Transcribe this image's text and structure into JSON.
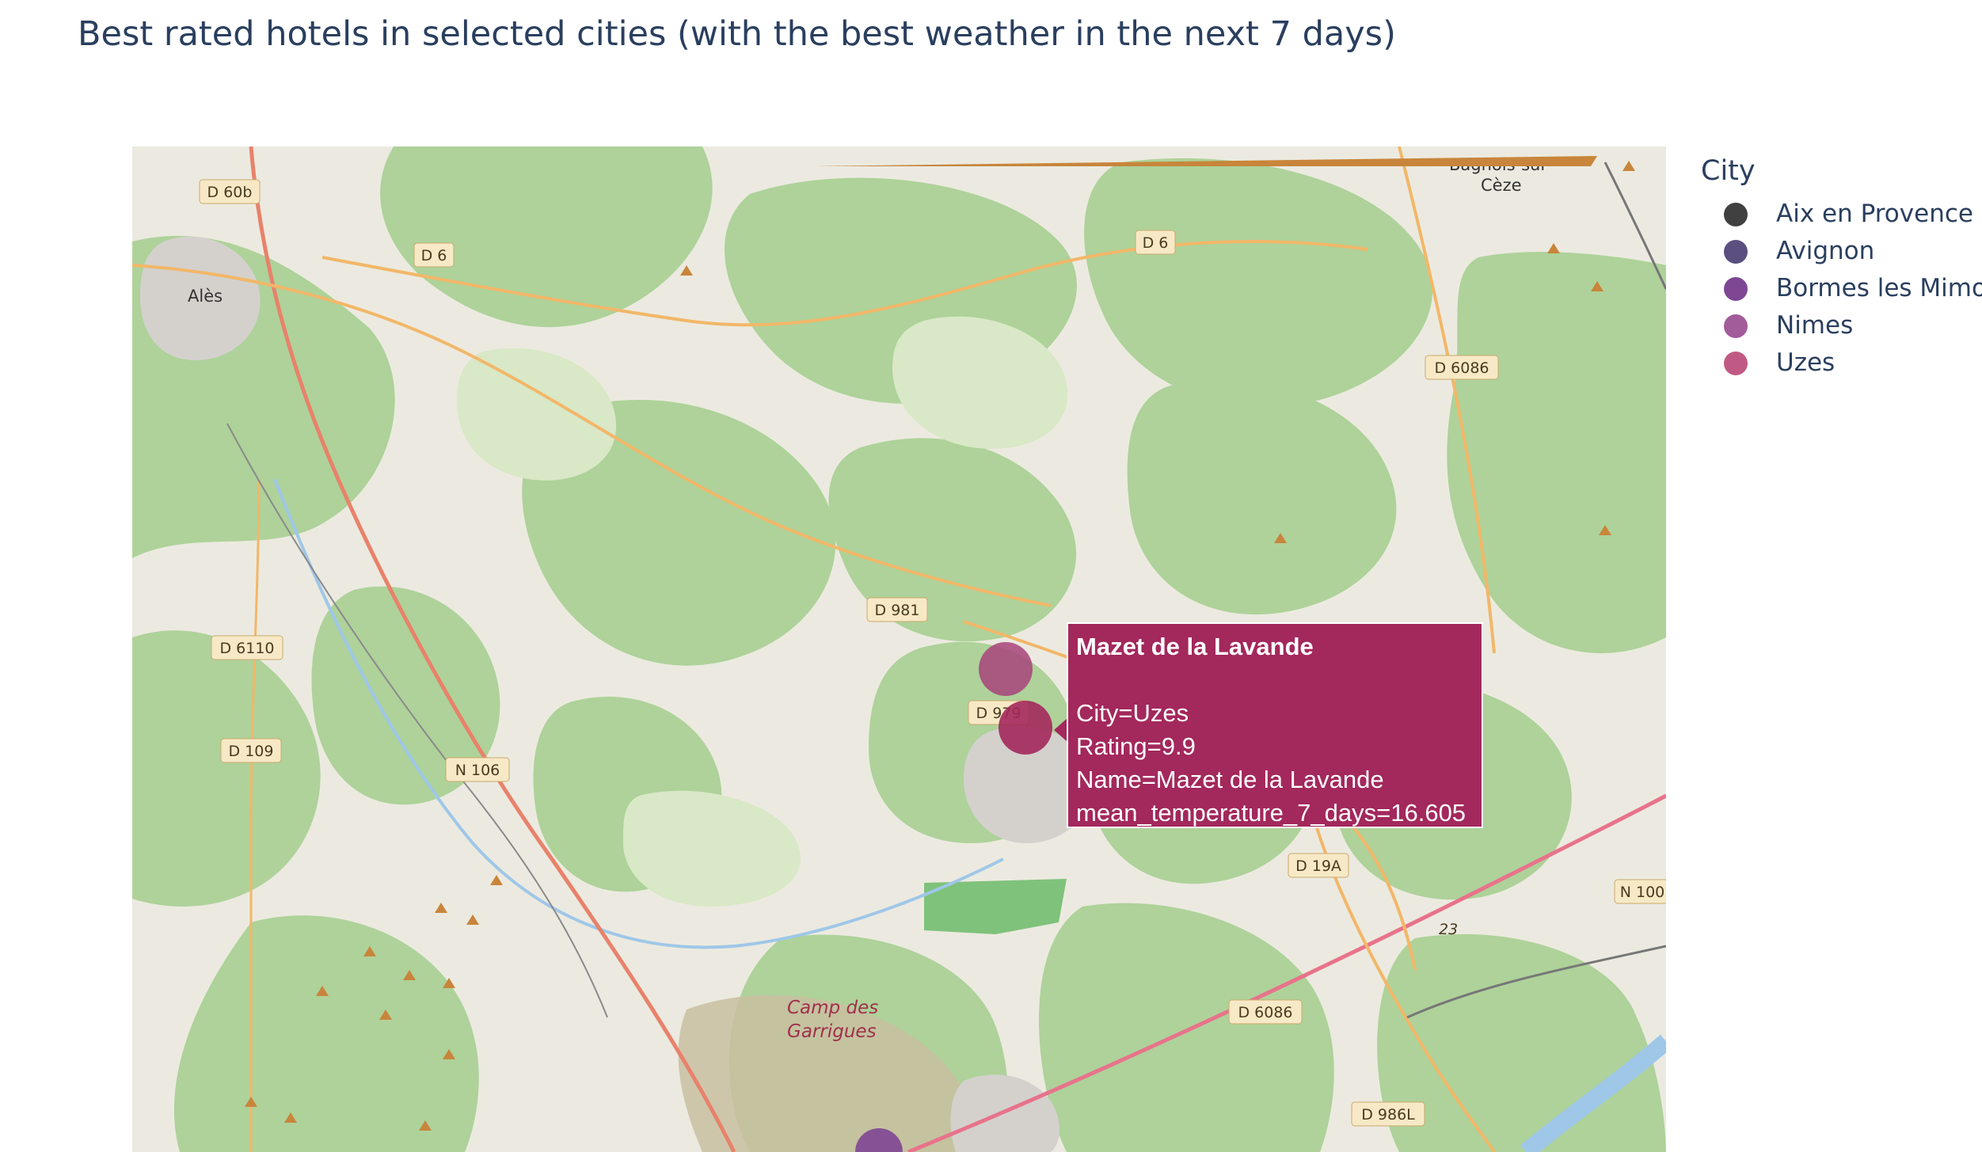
{
  "title": "Best rated hotels in selected cities (with the best weather in the next 7 days)",
  "legend": {
    "title": "City",
    "items": [
      {
        "label": "Aix en Provence",
        "color": "#404040"
      },
      {
        "label": "Avignon",
        "color": "#5a4f7f"
      },
      {
        "label": "Bormes les Mimosas",
        "color": "#7e4693"
      },
      {
        "label": "Nimes",
        "color": "#a25c99"
      },
      {
        "label": "Uzes",
        "color": "#c05a84"
      }
    ]
  },
  "map": {
    "place_labels": [
      "Alès",
      "Bagnols-sur-",
      "Cèze",
      "Camp des",
      "Garrigues"
    ],
    "road_labels": [
      "D 60b",
      "D 6",
      "D 6",
      "D 6086",
      "D 981",
      "D 979",
      "D 6110",
      "D 109",
      "N 106",
      "D 19A",
      "N 100",
      "D 6086",
      "D 986L",
      "23"
    ],
    "markers": [
      {
        "city": "Uzes",
        "color": "#a8437a",
        "highlighted": false
      },
      {
        "city": "Uzes",
        "color": "#a3285c",
        "highlighted": true
      },
      {
        "city": "Bormes les Mimosas",
        "color": "#7e4693",
        "highlighted": false
      }
    ]
  },
  "tooltip": {
    "name": "Mazet de la Lavande",
    "lines": [
      "City=Uzes",
      "Rating=9.9",
      "Name=Mazet de la Lavande",
      "mean_temperature_7_days=16.605"
    ],
    "background": "#a3285c"
  }
}
